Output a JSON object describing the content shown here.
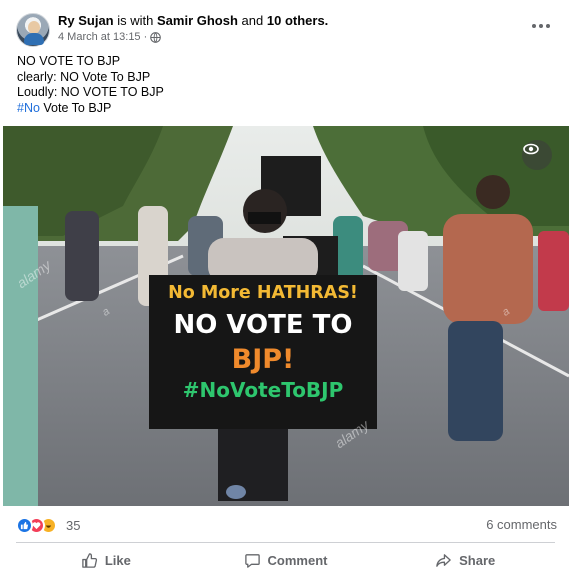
{
  "post": {
    "author": "Ry Sujan",
    "with_text": "is with",
    "tagged": "Samir Ghosh",
    "and_text": "and",
    "others": "10 others.",
    "timestamp": "4 March at 13:15",
    "separator": "·",
    "privacy_icon": "globe-icon",
    "lines": {
      "l1": "NO VOTE TO BJP",
      "l2": "clearly: NO Vote To BJP",
      "l3": "Loudly: NO VOTE TO BJP",
      "l4_hashtag": "#No",
      "l4_rest": " Vote To BJP"
    }
  },
  "photo": {
    "sign": {
      "line1": "No More  HATHRAS!",
      "line2": "NO VOTE TO",
      "line3": "BJP!",
      "line4": "#NoVoteToBJP"
    },
    "watermark": "alamy",
    "small_mark": "a"
  },
  "stats": {
    "reaction_count": "35",
    "comments": "6 comments",
    "reaction_icons": [
      "like-icon",
      "love-icon",
      "haha-icon"
    ]
  },
  "actions": {
    "like": "Like",
    "comment": "Comment",
    "share": "Share"
  },
  "colors": {
    "link_blue": "#216fdb",
    "muted": "#65676b",
    "like_blue": "#1b74e4",
    "love_red": "#f33e58",
    "haha_yellow": "#f7b125"
  }
}
